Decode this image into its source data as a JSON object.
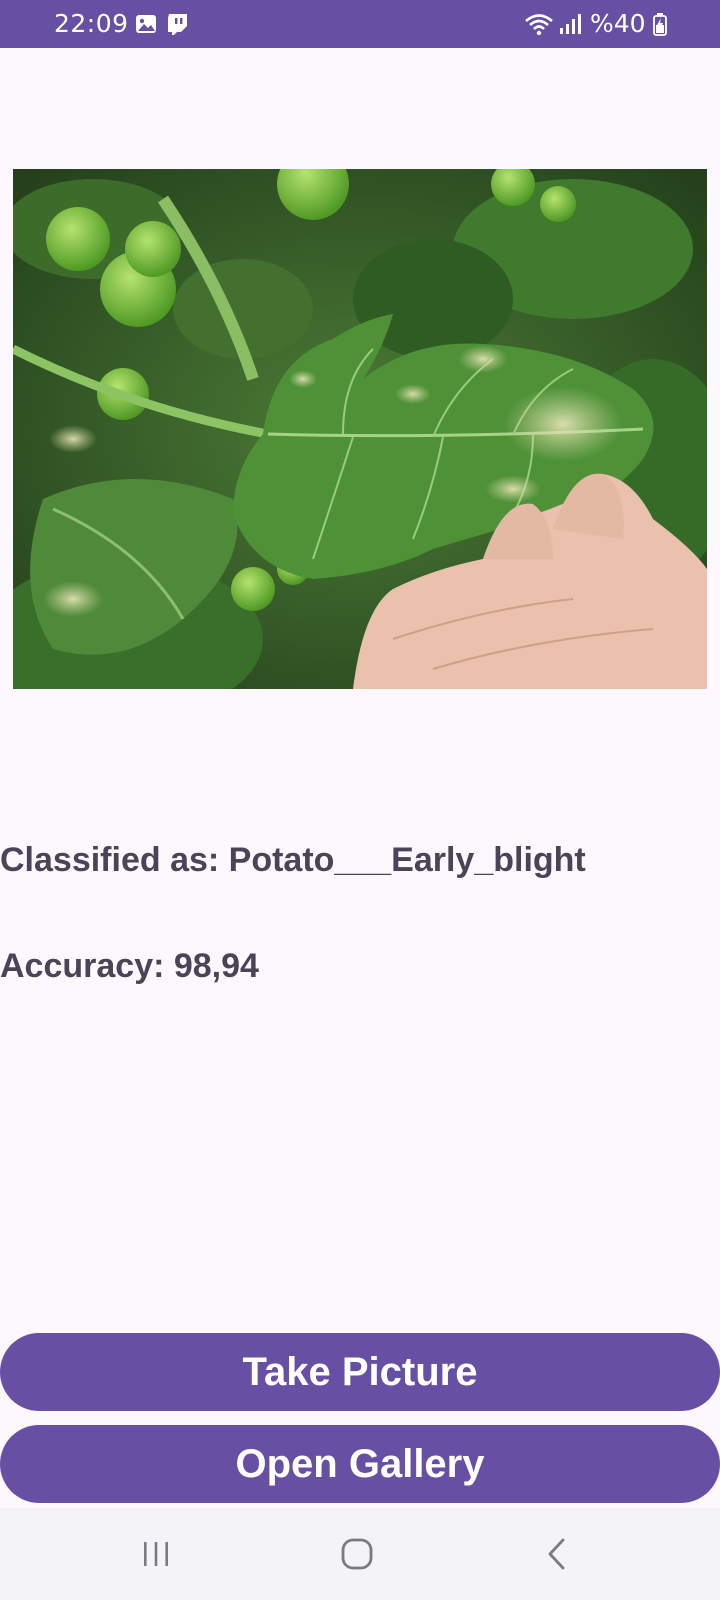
{
  "status_bar": {
    "time": "22:09",
    "battery": "%40",
    "icons": [
      "gallery-icon",
      "twitch-icon",
      "wifi-icon",
      "signal-icon",
      "battery-icon"
    ],
    "background": "#6750a4"
  },
  "image": {
    "description_icon": "leaf-photo"
  },
  "result": {
    "classified": "Classified as: Potato___Early_blight",
    "accuracy": "Accuracy: 98,94"
  },
  "buttons": {
    "take_picture": "Take Picture",
    "open_gallery": "Open Gallery"
  },
  "nav": {
    "icons": [
      "recent-apps-icon",
      "home-icon",
      "back-icon"
    ]
  },
  "colors": {
    "accent": "#6750a4",
    "text": "#4a4458",
    "background": "#fdf7fe"
  }
}
